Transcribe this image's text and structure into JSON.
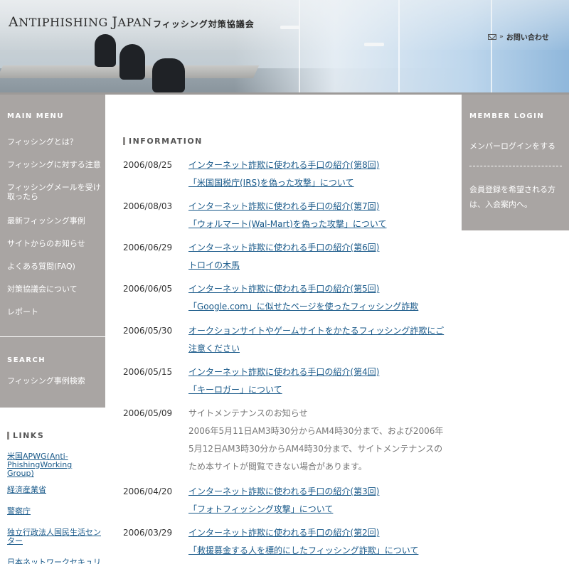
{
  "header": {
    "logo_en_big": "A",
    "logo_en_rest": "NTIPHISHING ",
    "logo_en_big2": "J",
    "logo_en_rest2": "APAN",
    "logo_jp": "フィッシング対策協議会",
    "contact_label": "お問い合わせ",
    "contact_arrow": "»"
  },
  "main_menu": {
    "title": "MAIN MENU",
    "items": [
      "フィッシングとは？",
      "フィッシングに対する注意",
      "フィッシングメールを受け取ったら",
      "最新フィッシング事例",
      "サイトからのお知らせ",
      "よくある質問(FAQ)",
      "対策協議会について",
      "レポート"
    ]
  },
  "search": {
    "title": "SEARCH",
    "item": "フィッシング事例検索"
  },
  "links": {
    "title": "LINKS",
    "items": [
      "米国APWG(Anti-PhishingWorking Group)",
      "経済産業省",
      "警察庁",
      "独立行政法人国民生活センター",
      "日本ネットワークセキュリ"
    ]
  },
  "member": {
    "title": "MEMBER LOGIN",
    "login": "メンバーログインをする",
    "note": "会員登録を希望される方は、入会案内へ。"
  },
  "information": {
    "title": "INFORMATION",
    "entries": [
      {
        "date": "2006/08/25",
        "line1": "インターネット詐欺に使われる手口の紹介(第8回)",
        "line2": "「米国国税庁(IRS)を偽った攻撃」について"
      },
      {
        "date": "2006/08/03",
        "line1": "インターネット詐欺に使われる手口の紹介(第7回)",
        "line2": "「ウォルマート(Wal-Mart)を偽った攻撃」について"
      },
      {
        "date": "2006/06/29",
        "line1": "インターネット詐欺に使われる手口の紹介(第6回)",
        "line2": "トロイの木馬"
      },
      {
        "date": "2006/06/05",
        "line1": "インターネット詐欺に使われる手口の紹介(第5回)",
        "line2": "「Google.com」に似せたページを使ったフィッシング詐欺"
      },
      {
        "date": "2006/05/30",
        "line1": "オークションサイトやゲームサイトをかたるフィッシング詐欺にご",
        "line2": "注意ください"
      },
      {
        "date": "2006/05/15",
        "line1": "インターネット詐欺に使われる手口の紹介(第4回)",
        "line2": "「キーロガー」について"
      },
      {
        "date": "2006/05/09",
        "line1": "サイトメンテナンスのお知らせ",
        "desc": "2006年5月11日AM3時30分からAM4時30分まで、および2006年5月12日AM3時30分からAM4時30分まで、サイトメンテナンスのため本サイトが閲覧できない場合があります。"
      },
      {
        "date": "2006/04/20",
        "line1": "インターネット詐欺に使われる手口の紹介(第3回)",
        "line2": "「フォトフィッシング攻撃」について"
      },
      {
        "date": "2006/03/29",
        "line1": "インターネット詐欺に使われる手口の紹介(第2回)",
        "line2": "「救援募金する人を標的にしたフィッシング詐欺」について"
      }
    ]
  }
}
